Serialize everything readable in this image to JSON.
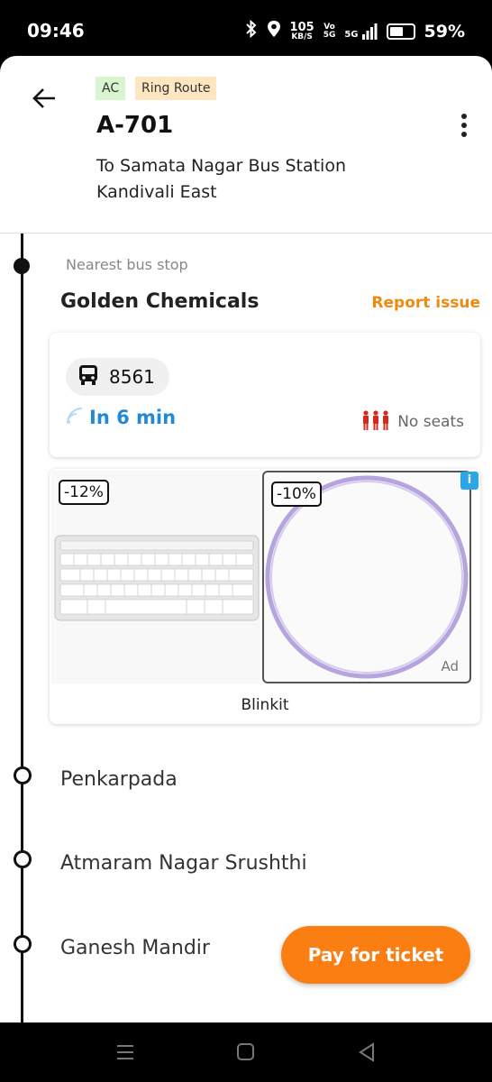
{
  "status_bar": {
    "time": "09:46",
    "data_speed_top": "105",
    "data_speed_bottom": "KB/S",
    "volte_top": "Vo",
    "volte_bottom": "5G",
    "network": "5G",
    "battery_text": "59%",
    "battery_level": 0.59
  },
  "header": {
    "tags": [
      "AC",
      "Ring Route"
    ],
    "route_title": "A-701",
    "destination": "To Samata Nagar Bus Station Kandivali East"
  },
  "nearest": {
    "label": "Nearest bus stop",
    "stop_name": "Golden Chemicals",
    "report_label": "Report issue"
  },
  "bus_card": {
    "bus_number": "8561",
    "eta": "In 6 min",
    "seats": "No seats"
  },
  "ad": {
    "left_discount": "-12%",
    "right_discount": "-10%",
    "info_label": "i",
    "ad_label": "Ad",
    "brand": "Blinkit"
  },
  "stops": [
    "Penkarpada",
    "Atmaram Nagar Srushthi",
    "Ganesh Mandir"
  ],
  "pay_button": "Pay for ticket",
  "colors": {
    "accent_orange": "#fb7e12",
    "eta_blue": "#2389d6",
    "seat_red": "#d8281e"
  }
}
